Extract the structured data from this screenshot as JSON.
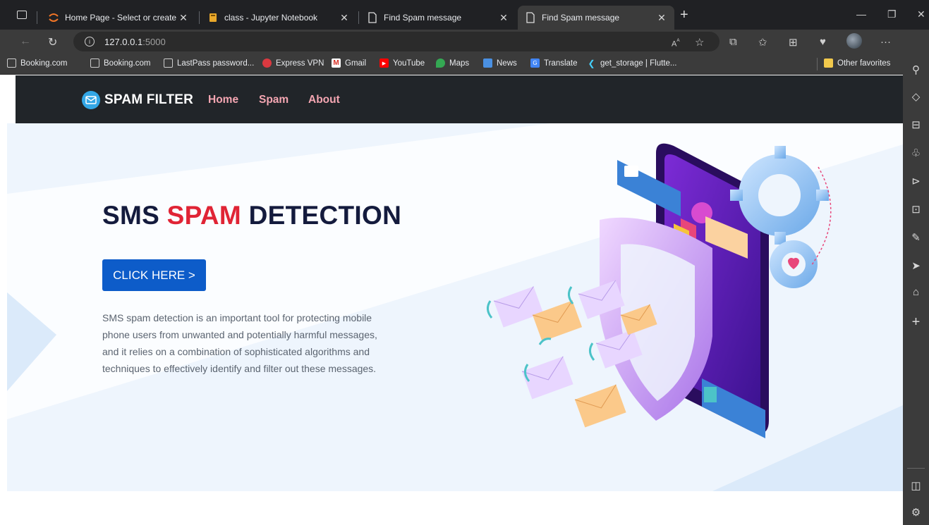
{
  "browser": {
    "tabs": [
      {
        "title": "Home Page - Select or create a n",
        "icon": "jupyter-icon"
      },
      {
        "title": "class - Jupyter Notebook",
        "icon": "notebook-icon"
      },
      {
        "title": "Find Spam message",
        "icon": "page-icon"
      },
      {
        "title": "Find Spam message",
        "icon": "page-icon"
      }
    ],
    "new_tab_label": "+",
    "url_host": "127.0.0.1",
    "url_port": ":5000",
    "bookmarks": [
      {
        "label": "Booking.com",
        "icon": "page-icon"
      },
      {
        "label": "Booking.com",
        "icon": "page-icon"
      },
      {
        "label": "LastPass password...",
        "icon": "page-icon"
      },
      {
        "label": "Express VPN",
        "icon": "expressvpn-icon"
      },
      {
        "label": "Gmail",
        "icon": "gmail-icon"
      },
      {
        "label": "YouTube",
        "icon": "youtube-icon"
      },
      {
        "label": "Maps",
        "icon": "maps-icon"
      },
      {
        "label": "News",
        "icon": "news-icon"
      },
      {
        "label": "Translate",
        "icon": "translate-icon"
      },
      {
        "label": "get_storage | Flutte...",
        "icon": "flutter-icon"
      }
    ],
    "other_favorites": "Other favorites"
  },
  "site": {
    "brand": "SPAM FILTER",
    "nav": [
      "Home",
      "Spam",
      "About"
    ],
    "hero": {
      "title_part1": "SMS ",
      "title_highlight": "SPAM",
      "title_part2": " DETECTION",
      "cta": "CLICK HERE >",
      "description": "SMS spam detection is an important tool for protecting mobile phone users from unwanted and potentially harmful messages, and it relies on a combination of sophisticated algorithms and techniques to effectively identify and filter out these messages."
    }
  },
  "colors": {
    "navbar": "#212529",
    "nav_link": "#f4a6b2",
    "title": "#141b3d",
    "highlight": "#e02435",
    "cta": "#0d5cc9",
    "hero_bg": "#eef5fd"
  }
}
